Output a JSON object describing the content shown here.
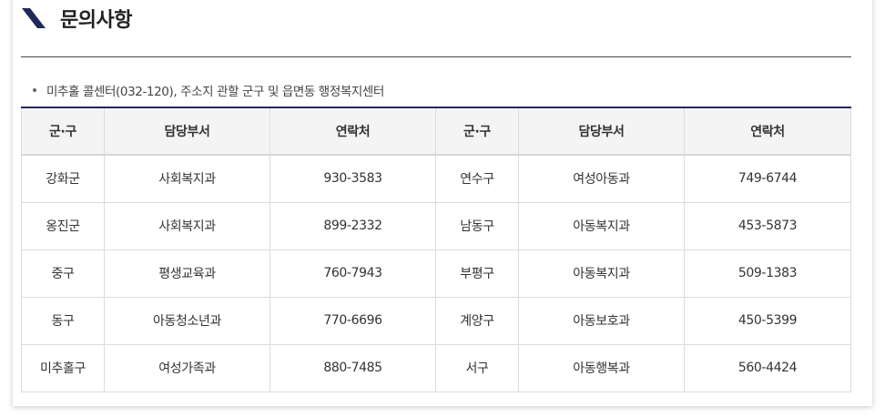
{
  "section": {
    "title": "문의사항",
    "notice": "미추홀 콜센터(032-120), 주소지 관할 군구 및 읍면동 행정복지센터"
  },
  "colors": {
    "accent": "#1f2a5c",
    "header_bg": "#f4f4f4",
    "border": "#dcdcdc"
  },
  "icons": {
    "heading": "slash-accent-icon"
  },
  "table": {
    "headers": [
      "군·구",
      "담당부서",
      "연락처",
      "군·구",
      "담당부서",
      "연락처"
    ],
    "rows": [
      [
        "강화군",
        "사회복지과",
        "930-3583",
        "연수구",
        "여성아동과",
        "749-6744"
      ],
      [
        "옹진군",
        "사회복지과",
        "899-2332",
        "남동구",
        "아동복지과",
        "453-5873"
      ],
      [
        "중구",
        "평생교육과",
        "760-7943",
        "부평구",
        "아동복지과",
        "509-1383"
      ],
      [
        "동구",
        "아동청소년과",
        "770-6696",
        "계양구",
        "아동보호과",
        "450-5399"
      ],
      [
        "미추홀구",
        "여성가족과",
        "880-7485",
        "서구",
        "아동행복과",
        "560-4424"
      ]
    ]
  }
}
